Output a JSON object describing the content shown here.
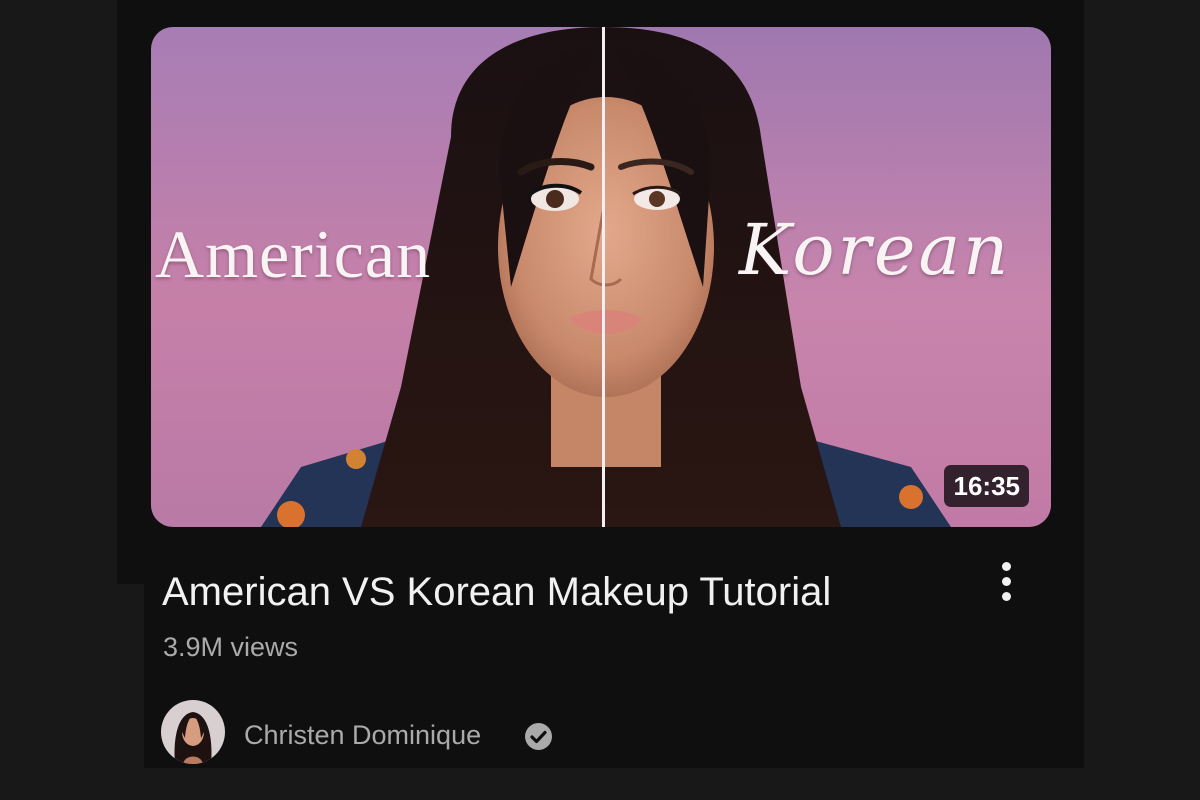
{
  "video": {
    "thumbnail": {
      "overlay_left": "American",
      "overlay_right": "Korean"
    },
    "duration": "16:35",
    "title": "American VS Korean Makeup Tutorial",
    "views": "3.9M views",
    "channel": {
      "name": "Christen Dominique",
      "verified": true,
      "verified_icon": "verified-checkmark-icon"
    },
    "menu_icon": "more-vertical-icon"
  },
  "colors": {
    "background": "#181818",
    "card": "#0f0f0f",
    "title": "#f1f1f1",
    "secondary_text": "#aaaaaa",
    "thumbnail_bg_left": "#b583b6",
    "thumbnail_bg_right": "#a57aac"
  }
}
